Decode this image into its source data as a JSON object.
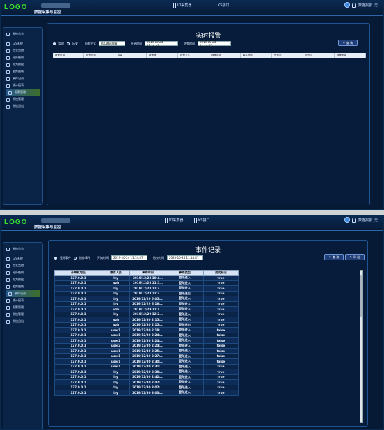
{
  "header": {
    "logo": "LOGO",
    "app_title": "数据采集与监控",
    "io_label": "IO采集器",
    "ks_label": "KS接口",
    "user_label": "数据报警",
    "user_status": "无"
  },
  "sidebar": {
    "title": "系统总览",
    "items": [
      {
        "label": "GIS系统",
        "icon": "globe-icon"
      },
      {
        "label": "工艺监控",
        "icon": "monitor-icon"
      },
      {
        "label": "拓扑结构",
        "icon": "topology-icon"
      },
      {
        "label": "电力数据",
        "icon": "bar-chart-icon"
      },
      {
        "label": "趋势曲线",
        "icon": "trend-icon"
      },
      {
        "label": "事件记录",
        "icon": "event-icon"
      },
      {
        "label": "统计报表",
        "icon": "report-icon"
      },
      {
        "label": "报警管理",
        "icon": "bell-icon"
      },
      {
        "label": "系统管理",
        "icon": "gear-icon"
      },
      {
        "label": "系统退出",
        "icon": "power-icon"
      }
    ]
  },
  "screen1": {
    "page_title": "实时报警",
    "radio_realtime": "实时",
    "radio_history": "历史",
    "alarm_type_label": "报警方式",
    "alarm_type_value": "PLC通讯故障",
    "start_label": "开始时间",
    "start_value": "2019-10-24 11:14:47",
    "end_label": "结束时间",
    "end_value": "2019-10-24 11:14:47",
    "query_button": "查 询",
    "columns": [
      "报警日期",
      "报警时间",
      "变量",
      "报警值",
      "报警方式",
      "报警描述",
      "事件状态",
      "处理态",
      "操作员",
      "报警来源"
    ]
  },
  "screen2": {
    "page_title": "事件记录",
    "radio_login": "登陆事件",
    "radio_operate": "操作事件",
    "start_label": "开始时间",
    "start_value": "2019-10-24 11:14:47",
    "end_label": "结束时间",
    "end_value": "2020-10-24 11:14:47",
    "query_button": "查 询",
    "export_button": "导 出",
    "columns": [
      "计算机地址",
      "操作人员",
      "事件时间",
      "事件类型",
      "成功标志"
    ],
    "rows": [
      [
        "127.0.0.1",
        "lzy",
        "2019/12/28 10:4...",
        "登陆进入",
        "true"
      ],
      [
        "127.0.0.1",
        "wzh",
        "2019/12/28 11:5...",
        "登陆进入",
        "true"
      ],
      [
        "127.0.0.1",
        "lzy",
        "2019/12/28 12:3...",
        "登陆进入",
        "true"
      ],
      [
        "127.0.0.1",
        "lzy",
        "2019/12/28 12:3...",
        "登陆退出",
        "true"
      ],
      [
        "127.0.0.1",
        "lzy",
        "2019/12/29 5:05:...",
        "登陆进入",
        "true"
      ],
      [
        "127.0.0.1",
        "lzy",
        "2019/12/29 6:18:...",
        "登陆进入",
        "true"
      ],
      [
        "127.0.0.1",
        "wzh",
        "2019/12/29 12:1...",
        "登陆进入",
        "true"
      ],
      [
        "127.0.0.1",
        "lzy",
        "2019/12/29 12:2...",
        "登陆进入",
        "true"
      ],
      [
        "127.0.0.1",
        "wzh",
        "2019/12/30 2:15:...",
        "登陆进入",
        "true"
      ],
      [
        "127.0.0.1",
        "wzh",
        "2019/12/30 2:15:...",
        "登陆退出",
        "true"
      ],
      [
        "127.0.0.1",
        "user1",
        "2019/12/30 2:18:...",
        "登陆进入",
        "false"
      ],
      [
        "127.0.0.1",
        "user1",
        "2019/12/30 2:24:...",
        "登陆进入",
        "false"
      ],
      [
        "127.0.0.1",
        "user2",
        "2019/12/30 2:24:...",
        "登陆进入",
        "false"
      ],
      [
        "127.0.0.1",
        "user2",
        "2019/12/30 2:24:...",
        "登陆进入",
        "false"
      ],
      [
        "127.0.0.1",
        "user1",
        "2019/12/30 2:25:...",
        "登陆进入",
        "false"
      ],
      [
        "127.0.0.1",
        "user1",
        "2019/12/30 2:27:...",
        "登陆进入",
        "false"
      ],
      [
        "127.0.0.1",
        "user1",
        "2019/12/30 2:30:...",
        "登陆进入",
        "false"
      ],
      [
        "127.0.0.1",
        "user1",
        "2019/12/30 2:31:...",
        "登陆进入",
        "true"
      ],
      [
        "127.0.0.1",
        "lzy",
        "2019/12/30 2:38:...",
        "登陆进入",
        "true"
      ],
      [
        "127.0.0.1",
        "lzy",
        "2019/12/30 2:42:...",
        "登陆进入",
        "true"
      ],
      [
        "127.0.0.1",
        "lzy",
        "2019/12/30 2:47:...",
        "登陆进入",
        "true"
      ],
      [
        "127.0.0.1",
        "lzy",
        "2019/12/30 3:02:...",
        "登陆进入",
        "true"
      ],
      [
        "127.0.0.1",
        "lzy",
        "2019/12/30 3:03:...",
        "登陆进入",
        "true"
      ]
    ]
  }
}
